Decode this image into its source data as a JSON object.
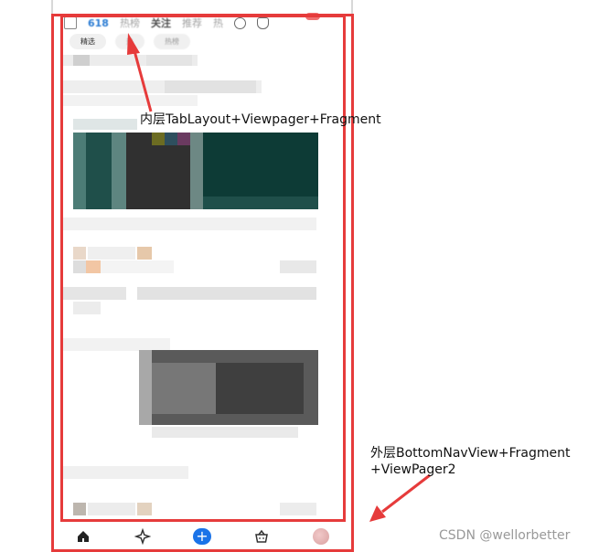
{
  "top_tabs": {
    "tab_618": "618",
    "tab_2": "热榜",
    "tab_3": "关注",
    "tab_4": "推荐",
    "tab_5": "热"
  },
  "chips": {
    "chip_1": "精选",
    "chip_2": "热",
    "chip_3": "热榜"
  },
  "annotations": {
    "inner": "内层TabLayout+Viewpager+Fragment",
    "outer_line1": "外层BottomNavView+Fragment",
    "outer_line2": "+ViewPager2"
  },
  "bottom_nav": {
    "plus_label": "+"
  },
  "watermark": "CSDN @wellorbetter",
  "colors": {
    "annotation_red": "#e63b3b",
    "accent_blue": "#1a73e8"
  }
}
